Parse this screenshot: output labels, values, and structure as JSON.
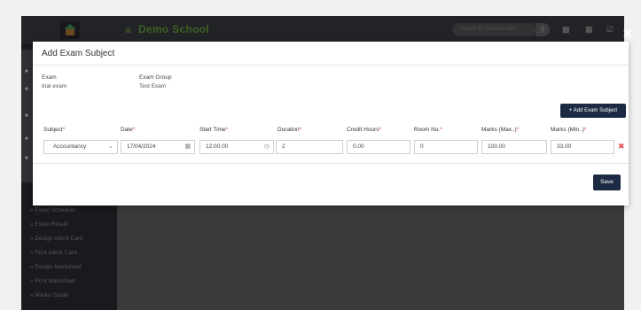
{
  "topbar": {
    "school_name": "Demo School",
    "hamburger": "≡",
    "search_placeholder": "Search By Student Nam",
    "icons": [
      "search-icon",
      "chart-icon",
      "calendar-icon",
      "task-icon"
    ]
  },
  "sidebar": {
    "items": [
      {
        "label": "» Exam Schedule"
      },
      {
        "label": "» Exam Result"
      },
      {
        "label": "» Design Admit Card"
      },
      {
        "label": "» Print Admit Card"
      },
      {
        "label": "» Design Marksheet"
      },
      {
        "label": "» Print Marksheet"
      },
      {
        "label": "» Marks Grade"
      }
    ]
  },
  "modal": {
    "title": "Add Exam Subject",
    "close": "✕",
    "exam_label": "Exam",
    "exam_value": "trial exam",
    "exam_group_label": "Exam Group",
    "exam_group_value": "Test Exam",
    "add_button": "+ Add Exam Subject",
    "save_button": "Save",
    "columns": [
      {
        "label": "Subject",
        "required": true
      },
      {
        "label": "Date",
        "required": true
      },
      {
        "label": "Start Time",
        "required": true
      },
      {
        "label": "Duration",
        "required": true
      },
      {
        "label": "Credit Hours",
        "required": true
      },
      {
        "label": "Room No.",
        "required": true
      },
      {
        "label": "Marks (Max..)",
        "required": true
      },
      {
        "label": "Marks (Min..)",
        "required": true
      }
    ],
    "row": {
      "subject": "Accountancy",
      "date": "17/04/2024",
      "start_time": "12:00:00",
      "duration": "2",
      "credit_hours": "0.00",
      "room_no": "0",
      "marks_max": "100.00",
      "marks_min": "33.00"
    },
    "required_mark": "*",
    "delete_icon": "✖"
  },
  "colors": {
    "topbar": "#3f4045",
    "brand_green": "#6cb33f",
    "button_navy": "#1c2b43",
    "required_red": "#d33333"
  }
}
